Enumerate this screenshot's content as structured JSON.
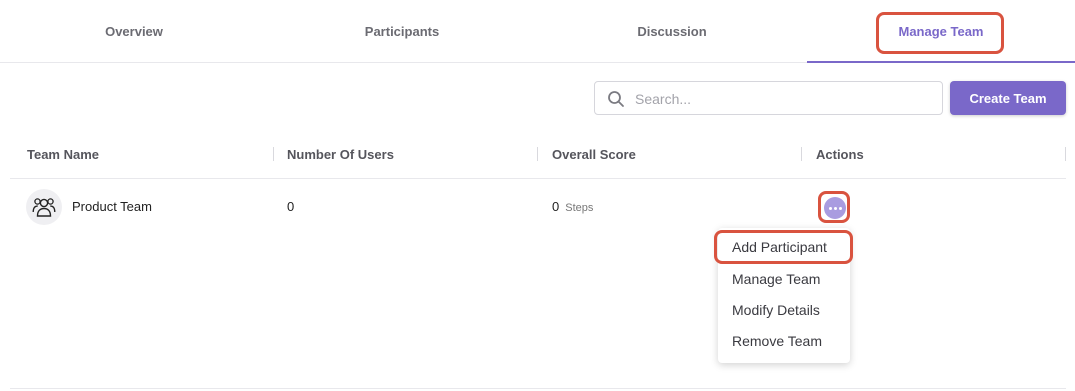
{
  "tabs": [
    {
      "label": "Overview"
    },
    {
      "label": "Participants"
    },
    {
      "label": "Discussion"
    },
    {
      "label": "Manage Team"
    }
  ],
  "active_tab": "Manage Team",
  "search": {
    "placeholder": "Search...",
    "value": ""
  },
  "create_team_label": "Create Team",
  "table": {
    "headers": [
      "Team Name",
      "Number Of Users",
      "Overall Score",
      "Actions"
    ],
    "rows": [
      {
        "team_name": "Product Team",
        "users": "0",
        "score": "0",
        "score_unit": "Steps"
      }
    ]
  },
  "actions_menu": [
    "Add Participant",
    "Manage Team",
    "Modify Details",
    "Remove Team"
  ],
  "colors": {
    "accent": "#7a68c9",
    "highlight": "#d9533f",
    "action_button": "#a99ce0"
  },
  "icons": {
    "search": "search-icon",
    "team_avatar": "users-group-icon",
    "more": "more-horizontal-icon"
  }
}
